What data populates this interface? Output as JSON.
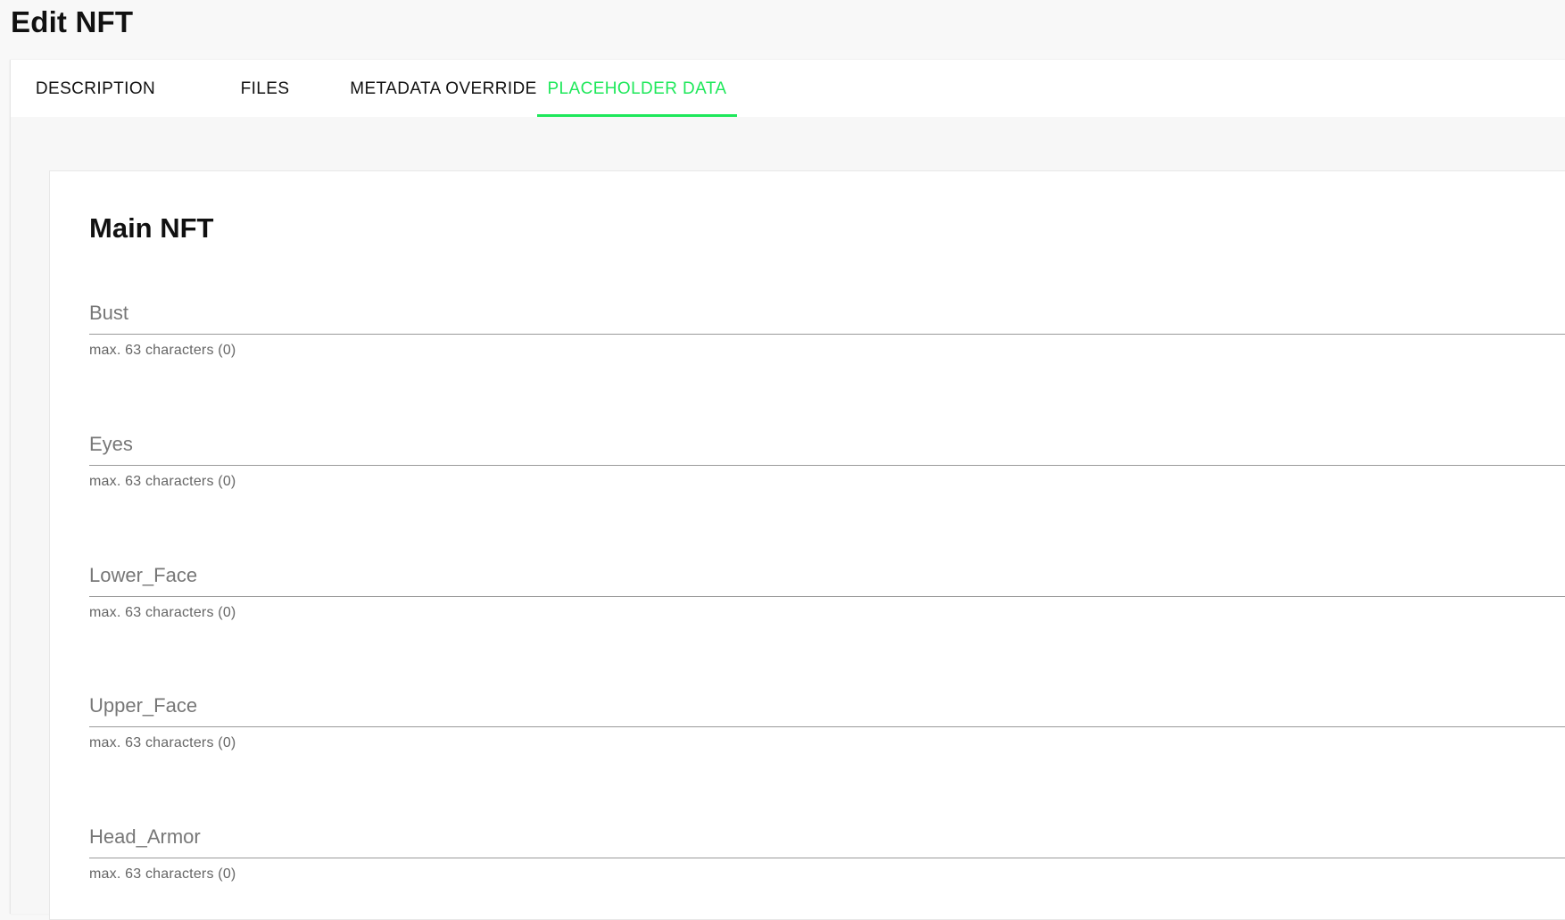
{
  "page": {
    "title": "Edit NFT"
  },
  "tabs": [
    {
      "label": "DESCRIPTION",
      "active": false
    },
    {
      "label": "FILES",
      "active": false
    },
    {
      "label": "METADATA OVERRIDE",
      "active": false
    },
    {
      "label": "PLACEHOLDER DATA",
      "active": true
    }
  ],
  "colors": {
    "accent": "#1ee85a",
    "background": "#f8f8f8",
    "card": "#ffffff",
    "helper_text": "#666666"
  },
  "section": {
    "title": "Main NFT",
    "fields": [
      {
        "placeholder": "Bust",
        "value": "",
        "helper": "max. 63 characters (0)"
      },
      {
        "placeholder": "Eyes",
        "value": "",
        "helper": "max. 63 characters (0)"
      },
      {
        "placeholder": "Lower_Face",
        "value": "",
        "helper": "max. 63 characters (0)"
      },
      {
        "placeholder": "Upper_Face",
        "value": "",
        "helper": "max. 63 characters (0)"
      },
      {
        "placeholder": "Head_Armor",
        "value": "",
        "helper": "max. 63 characters (0)"
      }
    ]
  }
}
